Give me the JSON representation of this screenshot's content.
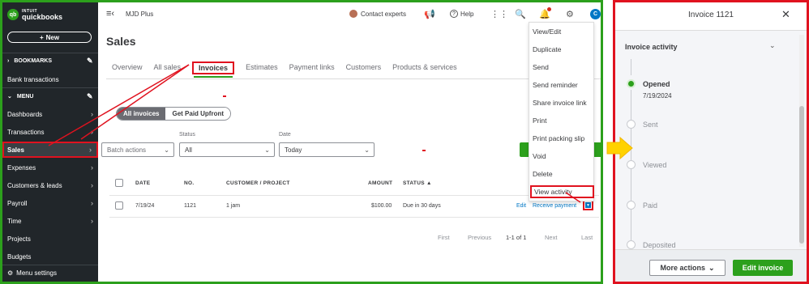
{
  "sidebar": {
    "logo_line1": "INTUIT",
    "logo_line2": "quickbooks",
    "logo_mark": "qb",
    "new_label": "New",
    "bookmarks_label": "BOOKMARKS",
    "bookmark_items": [
      "Bank transactions"
    ],
    "menu_label": "MENU",
    "items": [
      "Dashboards",
      "Transactions",
      "Sales",
      "Expenses",
      "Customers & leads",
      "Payroll",
      "Time",
      "Projects",
      "Budgets"
    ],
    "footer": "Menu settings"
  },
  "topbar": {
    "company": "MJD Plus",
    "contact": "Contact experts",
    "help": "Help",
    "user_initial": "C"
  },
  "page": {
    "title": "Sales",
    "tabs": [
      "Overview",
      "All sales",
      "Invoices",
      "Estimates",
      "Payment links",
      "Customers",
      "Products & services"
    ],
    "segments": [
      "All invoices",
      "Get Paid Upfront"
    ],
    "batch_actions": "Batch actions",
    "status_label": "Status",
    "status_value": "All",
    "date_label": "Date",
    "date_value": "Today"
  },
  "table": {
    "headers": [
      "DATE",
      "NO.",
      "CUSTOMER / PROJECT",
      "AMOUNT",
      "STATUS ▲"
    ],
    "row": {
      "date": "7/19/24",
      "no": "1121",
      "customer": "1 jam",
      "amount": "$100.00",
      "status": "Due in 30 days",
      "edit": "Edit",
      "receive": "Receive payment"
    },
    "pager": [
      "First",
      "Previous",
      "1-1 of 1",
      "Next",
      "Last"
    ]
  },
  "dropdown": {
    "items": [
      "View/Edit",
      "Duplicate",
      "Send",
      "Send reminder",
      "Share invoice link",
      "Print",
      "Print packing slip",
      "Void",
      "Delete",
      "View activity"
    ]
  },
  "panel": {
    "title": "Invoice 1121",
    "section": "Invoice activity",
    "steps": [
      {
        "label": "Opened",
        "date": "7/19/2024"
      },
      {
        "label": "Sent"
      },
      {
        "label": "Viewed"
      },
      {
        "label": "Paid"
      },
      {
        "label": "Deposited"
      }
    ],
    "more_actions": "More actions",
    "edit_invoice": "Edit invoice"
  },
  "colors": {
    "brand_green": "#2ca01c",
    "annotation_red": "#e0121f",
    "sidebar_bg": "#21262a",
    "link_blue": "#0077c5",
    "arrow_yellow": "#ffd200"
  }
}
